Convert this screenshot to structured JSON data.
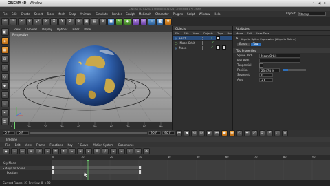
{
  "mac_menu": {
    "app": "CINEMA 4D",
    "items": [
      "Window"
    ],
    "right": [
      "Layout:"
    ]
  },
  "window_title": "CINEMA 4D R12.021 Studio (RC31024) - [Untitled 1 *] - Main",
  "main_menu": [
    "File",
    "Edit",
    "Create",
    "Select",
    "Tools",
    "Mesh",
    "Snap",
    "Animate",
    "Simulate",
    "Render",
    "Sculpt",
    "MoGraph",
    "Character",
    "Plugins",
    "Script",
    "Window",
    "Help"
  ],
  "layout_label": "Layout:",
  "layout_value": "Startup",
  "viewport": {
    "menu": [
      "View",
      "Cameras",
      "Display",
      "Options",
      "Filter",
      "Panel"
    ],
    "label": "Perspective"
  },
  "timeline_ruler": {
    "ticks": [
      "0",
      "10",
      "20",
      "30",
      "40",
      "50",
      "60",
      "70",
      "80",
      "90"
    ],
    "end_label": "0 F"
  },
  "transport": {
    "current": "0 F",
    "start": "0 F",
    "end": "90 F"
  },
  "objects_panel": {
    "title": "Objects",
    "menu": [
      "File",
      "Edit",
      "View",
      "Objects",
      "Tags",
      "Bookmarks"
    ],
    "rows": [
      {
        "name": "Earth",
        "selected": true
      },
      {
        "name": "Moon Orbit",
        "selected": false
      },
      {
        "name": "Moon",
        "selected": false
      }
    ]
  },
  "attributes_panel": {
    "title": "Attributes",
    "menu": [
      "Mode",
      "Edit",
      "User Data"
    ],
    "tag_header": "Align to Spline Expression [Align to Spline]",
    "tabs": [
      "Basic",
      "Tag"
    ],
    "section": "Tag Properties",
    "fields": [
      {
        "label": "Spline Path",
        "value": "Moon Orbit"
      },
      {
        "label": "Rail Path",
        "value": ""
      },
      {
        "label": "Tangential",
        "value": ""
      },
      {
        "label": "Position",
        "value": "23.474 %"
      },
      {
        "label": "Segment",
        "value": "0"
      },
      {
        "label": "Axis",
        "value": "+X"
      }
    ]
  },
  "timeline_window": {
    "title": "Timeline",
    "menu": [
      "File",
      "Edit",
      "View",
      "Frame",
      "Functions",
      "Key",
      "F-Curve",
      "Motion System",
      "Bookmarks"
    ],
    "left_rows": [
      "Key Mode",
      "Align to Spline",
      "Position"
    ],
    "ticks": [
      "0",
      "10",
      "20",
      "30",
      "40",
      "50",
      "60",
      "70",
      "80",
      "90"
    ],
    "status": "Current Frame: 21 Preview: 0-->90"
  },
  "colors": {
    "earth_ocean": "#2d5da8",
    "earth_land": "#c9a84a",
    "accent_blue": "#2f6fb8",
    "key_green": "#6fd16f"
  }
}
